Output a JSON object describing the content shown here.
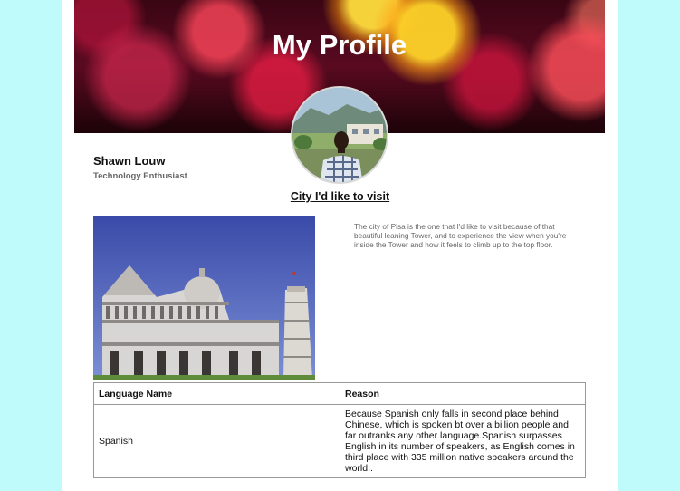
{
  "header": {
    "title": "My Profile"
  },
  "profile": {
    "name": "Shawn Louw",
    "subtitle": "Technology Enthusiast"
  },
  "city": {
    "heading": "City I'd like to visit",
    "description": "The city of Pisa is the one that I'd like to visit because of that beautiful leaning Tower, and to experience the view when you're inside the Tower and how it feels to climb up to the top floor."
  },
  "languages": {
    "headers": [
      "Language Name",
      "Reason"
    ],
    "rows": [
      {
        "name": "Spanish",
        "reason": "Because Spanish only falls in second place behind Chinese, which is spoken bt over a billion people and far outranks any other language.Spanish surpasses English in its number of speakers, as English comes in third place with 335 million native speakers around the world.."
      }
    ]
  }
}
